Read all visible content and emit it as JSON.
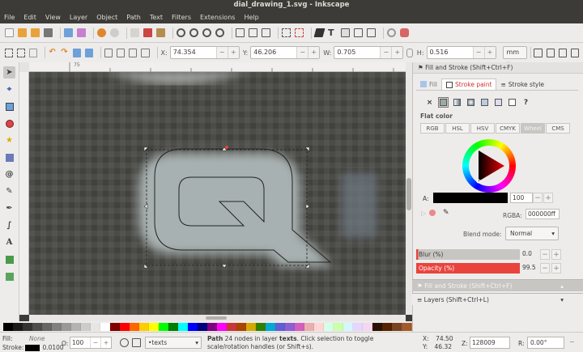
{
  "window": {
    "title": "dial_drawing_1.svg - Inkscape"
  },
  "menu": [
    "File",
    "Edit",
    "View",
    "Layer",
    "Object",
    "Path",
    "Text",
    "Filters",
    "Extensions",
    "Help"
  ],
  "controls": {
    "x_label": "X:",
    "x_value": "74.354",
    "y_label": "Y:",
    "y_value": "46.206",
    "w_label": "W:",
    "w_value": "0.705",
    "h_label": "H:",
    "h_value": "0.516",
    "unit": "mm"
  },
  "ruler": {
    "tick_75": "75"
  },
  "dock": {
    "header": "Fill and Stroke (Shift+Ctrl+F)",
    "tabs": [
      "Fill",
      "Stroke paint",
      "Stroke style"
    ],
    "unset_symbol": "×",
    "unknown_symbol": "?",
    "section_title": "Flat color",
    "modes": [
      "RGB",
      "HSL",
      "HSV",
      "CMYK",
      "Wheel",
      "CMS"
    ],
    "alpha_label": "A:",
    "alpha_value": "100",
    "rgba_label": "RGBA:",
    "rgba_value": "000000ff",
    "blend_label": "Blend mode:",
    "blend_value": "Normal",
    "blur_label": "Blur (%)",
    "blur_value": "0.0",
    "opacity_label": "Opacity (%)",
    "opacity_value": "99.5",
    "panel2": "Fill and Stroke (Shift+Ctrl+F)",
    "panel3": "Layers (Shift+Ctrl+L)"
  },
  "palette": [
    "#000000",
    "#1a1a1a",
    "#333333",
    "#4d4d4d",
    "#666666",
    "#808080",
    "#999999",
    "#b3b3b3",
    "#cccccc",
    "#e6e6e6",
    "#ffffff",
    "#800000",
    "#ff0000",
    "#ff6600",
    "#ffcc00",
    "#ffff00",
    "#00ff00",
    "#008000",
    "#00ffff",
    "#0000ff",
    "#000080",
    "#800080",
    "#ff00ff",
    "#c83737",
    "#aa4400",
    "#d4aa00",
    "#338000",
    "#00aad4",
    "#5f5fd3",
    "#8d5fd3",
    "#d35fbc",
    "#e9afaf",
    "#ffd5d5",
    "#d5ffe6",
    "#ccffaa",
    "#d5f6ff",
    "#e5d5ff",
    "#f4d7ee",
    "#2b1100",
    "#552200",
    "#784421",
    "#a05a2c",
    "#c87137",
    "#d38d5f",
    "#deaa87",
    "#e9c6af",
    "#f4e3d7"
  ],
  "status": {
    "fill_label": "Fill:",
    "fill_value": "None",
    "stroke_label": "Stroke:",
    "stroke_width": "0.0100",
    "o_label": "O:",
    "opacity": "100",
    "layer": "•texts",
    "message_bold": "Path",
    "message": " 24 nodes in layer ",
    "message_layer": "texts",
    "message_rest": ". Click selection to toggle scale/rotation handles (or Shift+s).",
    "x_label": "X:",
    "x": "74.50",
    "y_label": "Y:",
    "y": "46.32",
    "z_label": "Z:",
    "zoom": "128009",
    "r_label": "R:",
    "rotation": "0.00°"
  },
  "colors": {
    "accent_red": "#e8443d",
    "stroke_black": "#000000"
  }
}
